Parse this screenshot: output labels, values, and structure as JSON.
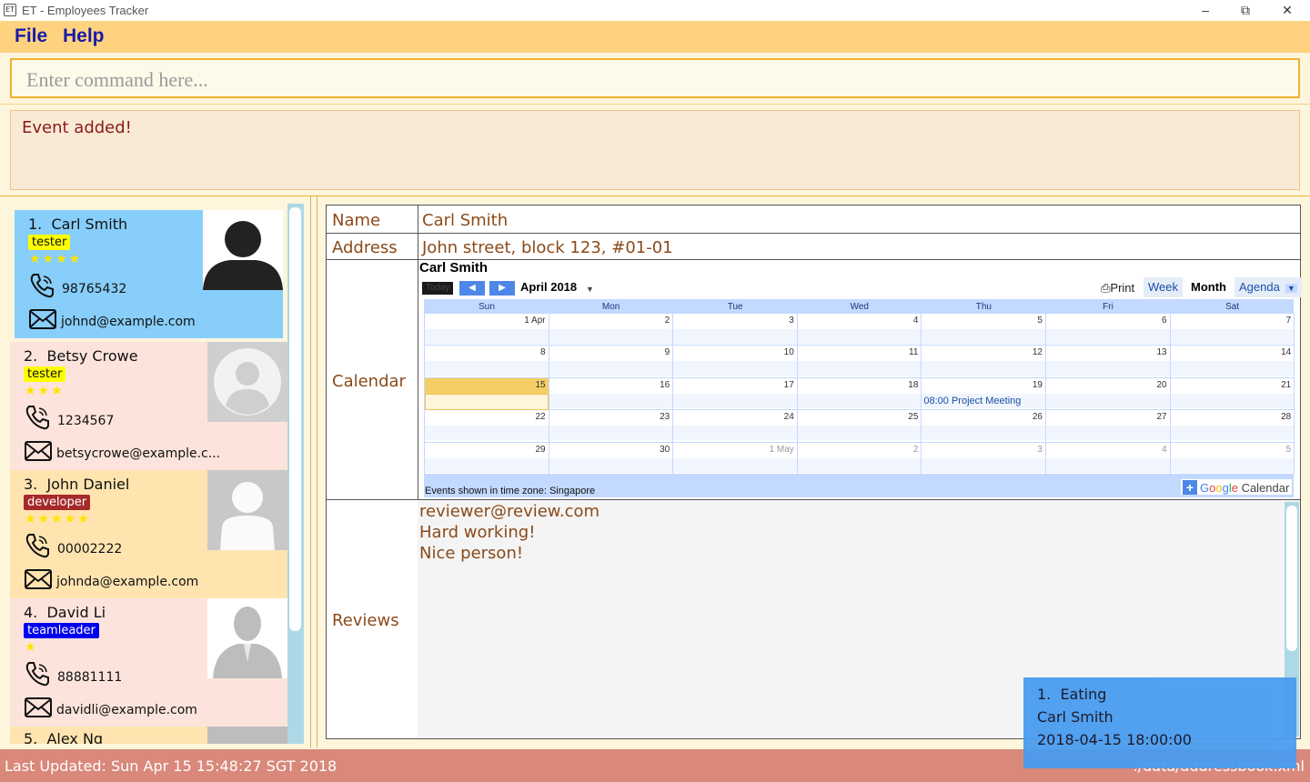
{
  "window": {
    "title": "ET - Employees Tracker",
    "icon_text": "ET",
    "controls": [
      "minimize-icon",
      "restore-icon",
      "close-icon"
    ]
  },
  "menu": {
    "file": "File",
    "help": "Help"
  },
  "command": {
    "placeholder": "Enter command here...",
    "value": ""
  },
  "result": {
    "text": "Event added!"
  },
  "persons": [
    {
      "index": "1.",
      "name": "Carl Smith",
      "tag": "tester",
      "tag_color": "#ffff00",
      "tag_text_color": "#111111",
      "rating": 4,
      "stars": "★★★★",
      "phone": "98765432",
      "email": "johnd@example.com",
      "bg": "#87cefa",
      "selected": true
    },
    {
      "index": "2.",
      "name": "Betsy Crowe",
      "tag": "tester",
      "tag_color": "#ffff00",
      "tag_text_color": "#111111",
      "rating": 3,
      "stars": "★★★",
      "phone": "1234567",
      "email": "betsycrowe@example.c...",
      "bg": "#fce4dc"
    },
    {
      "index": "3.",
      "name": "John Daniel",
      "tag": "developer",
      "tag_color": "#a52a2a",
      "tag_text_color": "#ffffff",
      "rating": 5,
      "stars": "★★★★★",
      "phone": "00002222",
      "email": "johnda@example.com",
      "bg": "#ffe4b0"
    },
    {
      "index": "4.",
      "name": "David Li",
      "tag": "teamleader",
      "tag_color": "#0000ee",
      "tag_text_color": "#ffffff",
      "rating": 1,
      "stars": "★",
      "phone": "88881111",
      "email": "davidli@example.com",
      "bg": "#fce4dc"
    },
    {
      "index": "5.",
      "name": "Alex Ng",
      "bg": "#ffe4b0"
    }
  ],
  "details": {
    "name_label": "Name",
    "name_value": "Carl Smith",
    "address_label": "Address",
    "address_value": "John street, block 123, #01-01",
    "calendar_label": "Calendar",
    "reviews_label": "Reviews",
    "reviews": [
      "reviewer@review.com",
      "Hard working!",
      "Nice person!"
    ]
  },
  "calendar": {
    "title": "Carl Smith",
    "today_button": "Today",
    "month_label": "April 2018",
    "print_label": "Print",
    "views": [
      "Week",
      "Month",
      "Agenda"
    ],
    "active_view": "Month",
    "day_headers": [
      "Sun",
      "Mon",
      "Tue",
      "Wed",
      "Thu",
      "Fri",
      "Sat"
    ],
    "weeks": [
      [
        "1 Apr",
        "2",
        "3",
        "4",
        "5",
        "6",
        "7"
      ],
      [
        "8",
        "9",
        "10",
        "11",
        "12",
        "13",
        "14"
      ],
      [
        "15",
        "16",
        "17",
        "18",
        "19",
        "20",
        "21"
      ],
      [
        "22",
        "23",
        "24",
        "25",
        "26",
        "27",
        "28"
      ],
      [
        "29",
        "30",
        "1 May",
        "2",
        "3",
        "4",
        "5"
      ]
    ],
    "today": "15",
    "event": {
      "date": "19",
      "text": "08:00 Project Meeting"
    },
    "timezone_text": "Events shown in time zone: Singapore",
    "brand": "Google Calendar"
  },
  "notification": {
    "index": "1.",
    "title": "Eating",
    "person": "Carl Smith",
    "datetime": "2018-04-15 18:00:00"
  },
  "status": {
    "last_updated": "Last Updated: Sun Apr 15 15:48:27 SGT 2018",
    "path": "./data/addressbook.xml"
  },
  "colors": {
    "menu_bg": "#ffd27f",
    "accent_orange": "#f0b232",
    "status_bg": "#d9887a",
    "result_text": "#8b1a1a",
    "detail_text": "#8b4a1a",
    "notification_bg": "#4a9cf0"
  }
}
